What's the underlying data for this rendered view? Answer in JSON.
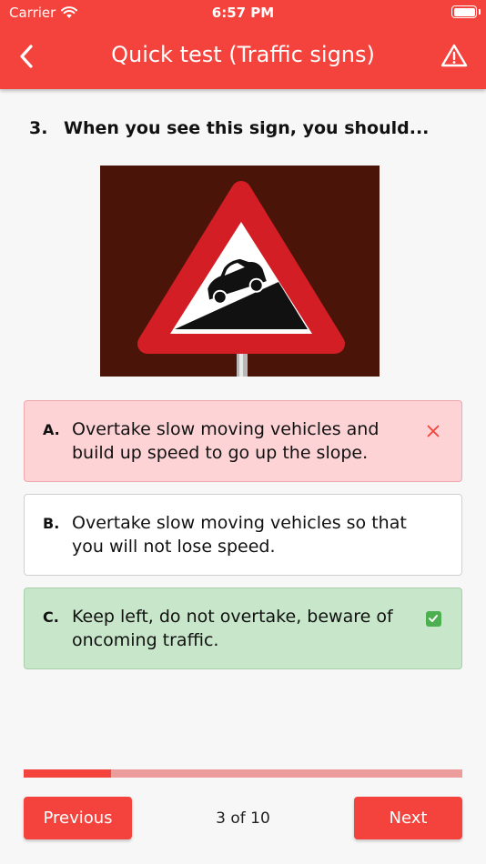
{
  "status_bar": {
    "carrier": "Carrier",
    "time": "6:57 PM",
    "battery_level": 1.0
  },
  "header": {
    "title": "Quick test (Traffic signs)",
    "back_icon": "chevron-left-icon",
    "report_icon": "warning-triangle-icon",
    "color": "#f4433c"
  },
  "question": {
    "number": "3.",
    "text": "When you see this sign, you should..."
  },
  "options": [
    {
      "letter": "A.",
      "text": "Overtake slow moving vehicles and build up speed to go up the slope.",
      "state": "wrong",
      "icon": "close-icon"
    },
    {
      "letter": "B.",
      "text": "Overtake slow moving vehicles so that you will not lose speed.",
      "state": "neutral"
    },
    {
      "letter": "C.",
      "text": "Keep left, do not overtake, beware of oncoming traffic.",
      "state": "correct",
      "icon": "checkbox-checked-icon"
    }
  ],
  "progress": {
    "value": 0.2,
    "fill_color": "#f4433c",
    "track_color": "#ec9c9a"
  },
  "navigation": {
    "previous_label": "Previous",
    "counter": "3 of 10",
    "next_label": "Next"
  }
}
